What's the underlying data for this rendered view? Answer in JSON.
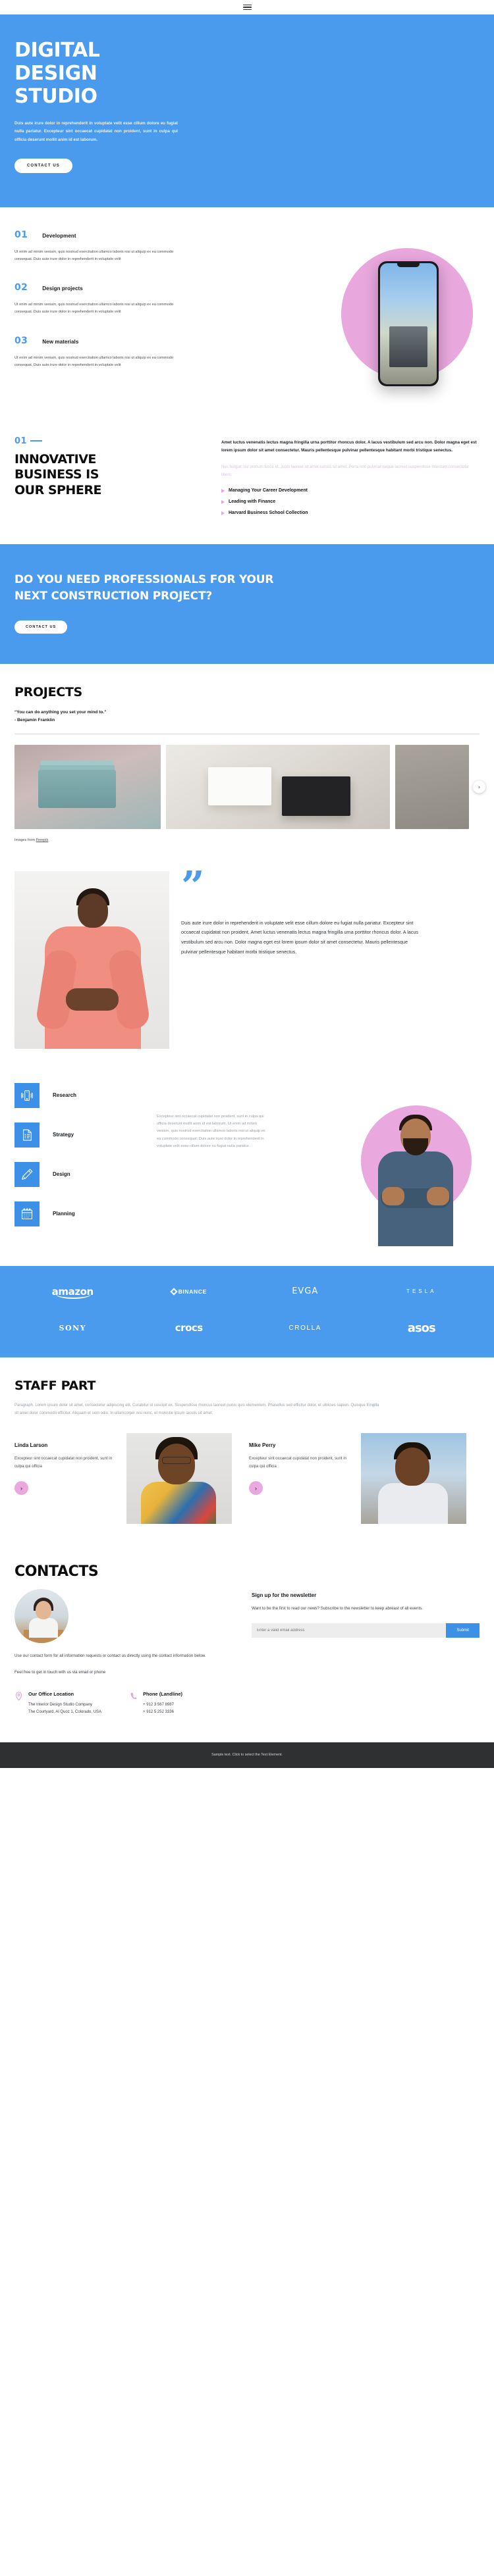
{
  "nav": {
    "menu_label": "menu"
  },
  "hero": {
    "title_lines": [
      "DIGITAL",
      "DESIGN",
      "STUDIO"
    ],
    "paragraph": "Duis aute irure dolor in reprehenderit in voluptate velit esse cillum dolore eu fugiat nulla pariatur. Excepteur sint occaecat cupidatat non proident, sunt in culpa qui officia deserunt mollit anim id est laborum.",
    "cta_label": "CONTACT US",
    "bg_color": "#4a9bed"
  },
  "features": {
    "items": [
      {
        "number": "01",
        "title": "Development",
        "body": "Ut enim ad minim veniam, quis nostrud exercitation ullamco laboris nisi ut aliquip ex ea commodo consequat. Duis aute irure dolor in reprehenderit in voluptate velit"
      },
      {
        "number": "02",
        "title": "Design projects",
        "body": "Ut enim ad minim veniam, quis nostrud exercitation ullamco laboris nisi ut aliquip ex ea commodo consequat. Duis aute irure dolor in reprehenderit in voluptate velit"
      },
      {
        "number": "03",
        "title": "New materials",
        "body": "Ut enim ad minim veniam, quis nostrud exercitation ullamco laboris nisi ut aliquip ex ea commodo consequat. Duis aute irure dolor in reprehenderit in voluptate velit"
      }
    ]
  },
  "innovative": {
    "number": "01",
    "heading_lines": [
      "INNOVATIVE",
      "BUSINESS IS",
      "OUR SPHERE"
    ],
    "lead": "Amet luctus venenatis lectus magna fringilla urna porttitor rhoncus dolor. A lacus vestibulum sed arcu non. Dolor magna eget est lorem ipsum dolor sit amet consectetur. Mauris pellentesque pulvinar pellentesque habitant morbi tristique senectus.",
    "muted": "Nec feugiat nisl pretium fusce id. Justo laoreet sit amet cursus sit amet. Porta non pulvinar neque laoreet suspendisse interdum consectetur libero.",
    "links": [
      "Managing Your Career Development",
      "Leading with Finance",
      "Harvard Business School Collection"
    ]
  },
  "cta_banner": {
    "heading": "DO YOU NEED PROFESSIONALS FOR YOUR NEXT CONSTRUCTION PROJECT?",
    "button_label": "CONTACT US"
  },
  "projects": {
    "title": "PROJECTS",
    "quote": "“You can do anything you set your mind to.”",
    "author": "- Benjamin Franklin",
    "next_icon": "›",
    "credit_prefix": "Images from ",
    "credit_link": "Freepik"
  },
  "testimonial": {
    "quote_glyph": "”",
    "text": "Duis aute irure dolor in reprehenderit in voluptate velit esse cillum dolore eu fugiat nulla pariatur. Excepteur sint occaecat cupidatat non proident. Amet luctus venenatis lectus magna fringilla urna porttitor rhoncus dolor. A lacus vestibulum sed arcu non. Dolor magna eget est lorem ipsum dolor sit amet consectetur. Mauris pellentesque pulvinar pellentesque habitant morbi tristique senectus."
  },
  "services": {
    "items": [
      {
        "label": "Research",
        "icon": "smartphone-icon"
      },
      {
        "label": "Strategy",
        "icon": "document-checklist-icon"
      },
      {
        "label": "Design",
        "icon": "pencil-icon"
      },
      {
        "label": "Planning",
        "icon": "calendar-icon"
      }
    ],
    "copy": "Excepteur sint occaecat cupidatat non proident, sunt in culpa qui officia deserunt mollit anim id est laborum. Ut enim ad minim veniam, quis nostrud exercitation ullamco laboris nisi ut aliquip ex ea commodo consequat. Duis aute irure dolor in reprehenderit in voluptate velit esse cillum dolore eu fugiat nulla pariatur."
  },
  "brands": {
    "row1": [
      "amazon",
      "BINANCE",
      "EVGA",
      "TESLA"
    ],
    "row2": [
      "SONY",
      "crocs",
      "CROLLA",
      "asos"
    ]
  },
  "staff": {
    "title": "STAFF PART",
    "intro": "Paragraph. Lorem ipsum dolor sit amet, consectetur adipiscing elit. Curabitur id suscipit ex. Suspendisse rhoncus laoreet purus quis elementum. Phasellus sed efficitur dolor, et ultricies sapien. Quisque fringilla sit amet dolor commodo efficitur. Aliquam et sem odio. In ullamcorper nisi nunc, et molestie ipsum iaculis sit amet.",
    "members": [
      {
        "name": "Linda Larson",
        "desc": "Excepteur sint occaecat cupidatat non proident, sunt in culpa qui officia",
        "arrow": "›"
      },
      {
        "name": "Mike Perry",
        "desc": "Excepteur sint occaecat cupidatat non proident, sunt in culpa qui officia",
        "arrow": "›"
      }
    ]
  },
  "contacts": {
    "title": "CONTACTS",
    "note_line1": "Use our contact form for all information requests or contact us directly using the contact information below.",
    "note_line2": "Feel free to get in touch with us via email or phone",
    "office": {
      "icon": "map-pin-icon",
      "title": "Our Office Location",
      "line1": "The Interior Design Studio Company",
      "line2": "The Courtyard, Al Quoz 1, Colorado,  USA"
    },
    "phone": {
      "icon": "phone-icon",
      "title": "Phone (Landline)",
      "line1": "+ 912 3 567 8987",
      "line2": "+ 912 5 252 3336"
    },
    "newsletter": {
      "title": "Sign up for the newsletter",
      "subtitle": "Want to be the first to read our news? Subscribe to the newsletter to keep abreast of all events.",
      "placeholder": "Enter a valid email address",
      "submit_label": "Submit"
    }
  },
  "footer": {
    "text": "Sample text. Click to select the Text Element."
  }
}
